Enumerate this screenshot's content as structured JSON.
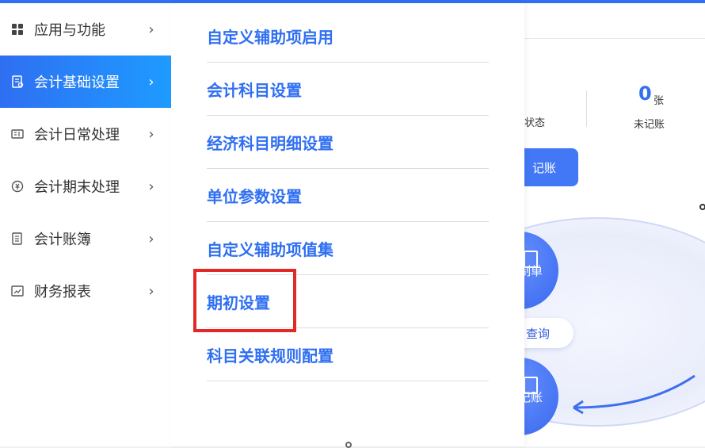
{
  "sidebar": {
    "items": [
      {
        "label": "应用与功能",
        "icon": "apps-grid-icon"
      },
      {
        "label": "会计基础设置",
        "icon": "settings-doc-icon",
        "active": true
      },
      {
        "label": "会计日常处理",
        "icon": "voucher-icon"
      },
      {
        "label": "会计期末处理",
        "icon": "period-end-icon"
      },
      {
        "label": "会计账簿",
        "icon": "ledger-book-icon"
      },
      {
        "label": "财务报表",
        "icon": "report-icon"
      }
    ],
    "chevron": "›"
  },
  "submenu": {
    "items": [
      {
        "label": "自定义辅助项启用"
      },
      {
        "label": "会计科目设置"
      },
      {
        "label": "经济科目明细设置"
      },
      {
        "label": "单位参数设置"
      },
      {
        "label": "自定义辅助项值集"
      },
      {
        "label": "期初设置",
        "highlighted": true
      },
      {
        "label": "科目关联规则配置"
      }
    ]
  },
  "dashboard": {
    "stat_fragment_top": "",
    "stat_fragment_label": "状态",
    "unrecorded_count": "0",
    "unrecorded_unit": "张",
    "unrecorded_label": "未记账",
    "post_button": "记账",
    "flow": {
      "make_voucher": "制单",
      "query": "查询",
      "post": "记账"
    }
  },
  "colors": {
    "accent": "#2f6ff2",
    "highlight_box": "#e32828"
  }
}
